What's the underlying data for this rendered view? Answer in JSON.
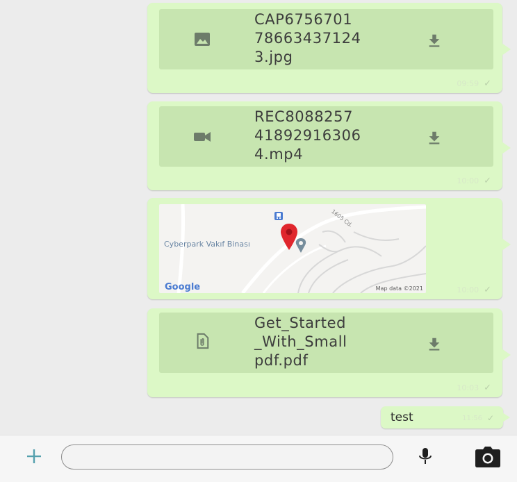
{
  "colors": {
    "chat_background": "#ececec",
    "outgoing_bubble": "#dcf8c6",
    "file_card": "#c7e5b0",
    "icon_gray": "#6d7c6a",
    "accent_plus": "#54a0ad",
    "pin_red": "#e0262d"
  },
  "messages": [
    {
      "type": "file",
      "icon": "image-icon",
      "file_name": "CAP6756701\n78663437124\n3.jpg",
      "time": "09:59",
      "status_icon": "check-icon"
    },
    {
      "type": "file",
      "icon": "video-icon",
      "file_name": "REC8088257\n41892916306\n4.mp4",
      "time": "10:00",
      "status_icon": "check-icon"
    },
    {
      "type": "location",
      "map_place_label": "Cyberpark Vakıf Binası",
      "map_road_label": "1605 Cd.",
      "map_logo": "Google",
      "map_attribution": "Map data ©2021",
      "time": "10:00",
      "status_icon": "check-icon"
    },
    {
      "type": "file",
      "icon": "document-icon",
      "file_name": "Get_Started\n_With_Small\npdf.pdf",
      "time": "10:03",
      "status_icon": "check-icon"
    },
    {
      "type": "text",
      "text": "test",
      "time": "11:56",
      "status_icon": "check-icon"
    }
  ],
  "composer": {
    "input_value": "",
    "input_placeholder": "",
    "attach_icon": "plus-icon",
    "mic_icon": "microphone-icon",
    "camera_icon": "camera-icon"
  }
}
